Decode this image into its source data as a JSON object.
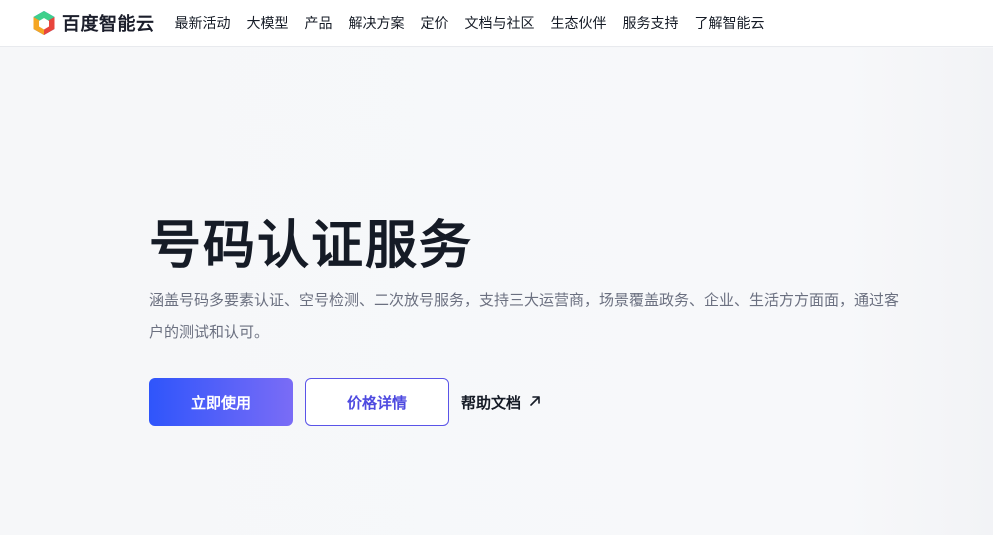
{
  "header": {
    "brand": "百度智能云",
    "logo_icon": "baidu-cloud-hexagon-icon",
    "nav": [
      "最新活动",
      "大模型",
      "产品",
      "解决方案",
      "定价",
      "文档与社区",
      "生态伙伴",
      "服务支持",
      "了解智能云"
    ]
  },
  "hero": {
    "title": "号码认证服务",
    "description": "涵盖号码多要素认证、空号检测、二次放号服务，支持三大运营商，场景覆盖政务、企业、生活方方面面，通过客户的测试和认可。",
    "primary_button": "立即使用",
    "secondary_button": "价格详情",
    "link_button": "帮助文档",
    "link_icon": "arrow-up-right-icon"
  },
  "colors": {
    "primary_gradient_start": "#2f55fb",
    "primary_gradient_end": "#7a6cf6",
    "secondary_border": "#5a54e8",
    "title_text": "#151b26",
    "desc_text": "#6b7080",
    "page_bg": "#f6f7f9"
  }
}
